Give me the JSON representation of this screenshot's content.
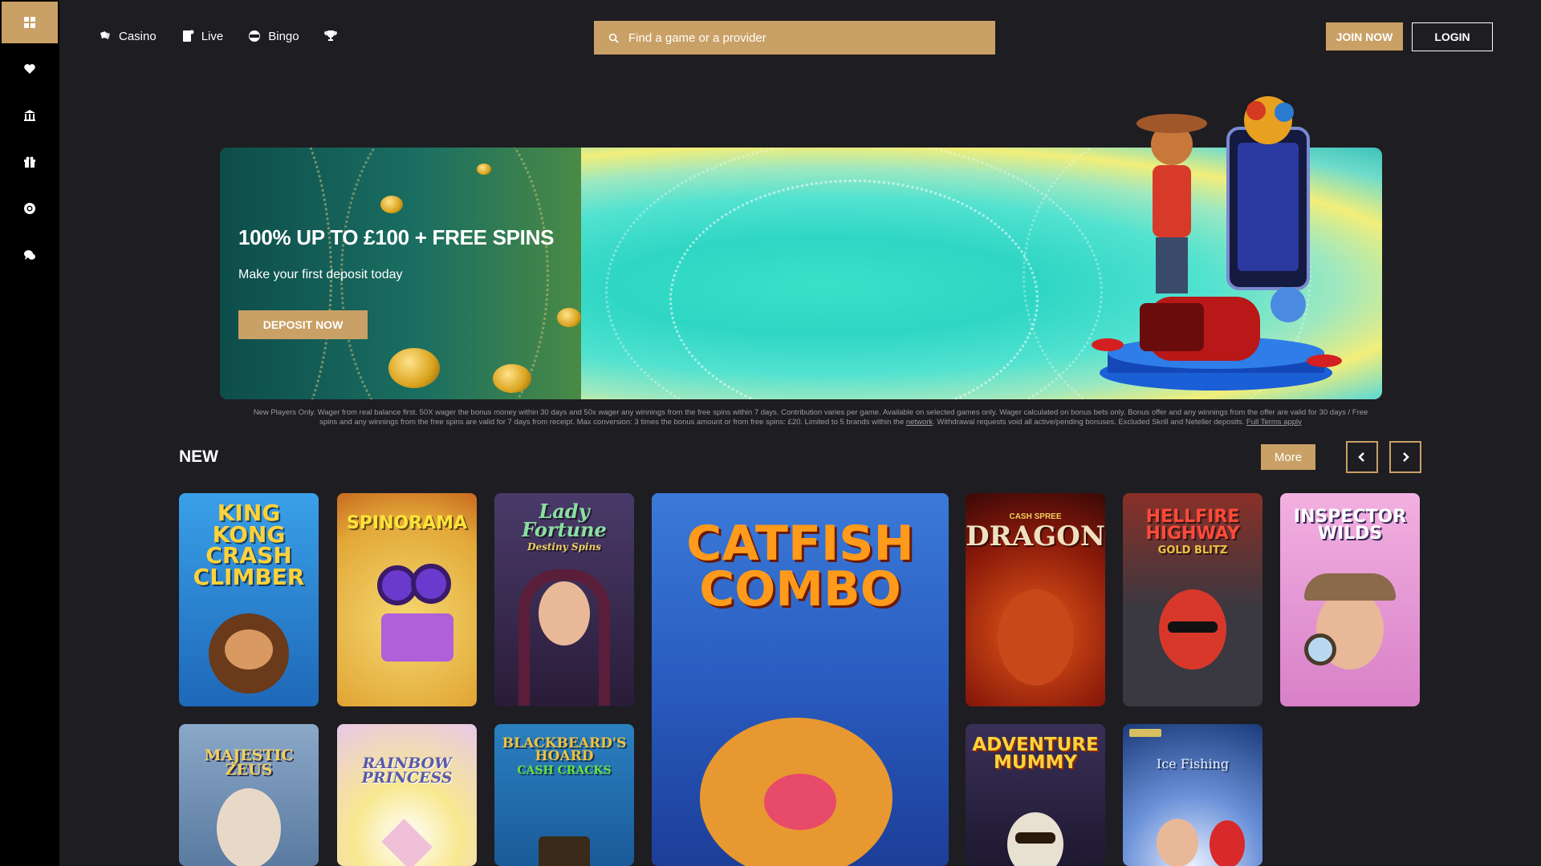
{
  "sidebar": {
    "items": [
      {
        "icon": "grid-icon"
      },
      {
        "icon": "heart-icon"
      },
      {
        "icon": "building-icon"
      },
      {
        "icon": "gift-icon"
      },
      {
        "icon": "lifebuoy-icon"
      },
      {
        "icon": "chat-icon"
      }
    ]
  },
  "header": {
    "nav": [
      {
        "label": "Casino",
        "icon": "cards-icon"
      },
      {
        "label": "Live",
        "icon": "live-cards-icon"
      },
      {
        "label": "Bingo",
        "icon": "bingo-ball-icon"
      },
      {
        "label": "",
        "icon": "trophy-icon"
      }
    ],
    "search_placeholder": "Find a game or a provider",
    "join_label": "JOIN NOW",
    "login_label": "LOGIN"
  },
  "banner": {
    "title": "100% UP TO £100 + FREE SPINS",
    "subtitle": "Make your first deposit today",
    "cta_label": "DEPOSIT NOW"
  },
  "terms": {
    "text_1": "New Players Only. Wager from real balance first. 50X wager the bonus money within 30 days and 50x wager any winnings from the free spins within 7 days. Contribution varies per game. Available on selected games only. Wager calculated on bonus bets only. Bonus offer and any winnings from the offer are valid for 30 days / Free spins and any winnings from the free spins are valid for 7 days from receipt. Max conversion: 3 times the bonus amount or from free spins: £20. Limited to 5 brands within the ",
    "link_network": "network",
    "text_2": ". Withdrawal requests void all active/pending bonuses. Excluded Skrill and Neteller deposits. ",
    "link_full_terms": "Full Terms apply"
  },
  "new_section": {
    "title": "NEW",
    "more_label": "More",
    "games": [
      {
        "title": "KING KONG CRASH CLIMBER",
        "bg": "#2a8fd6"
      },
      {
        "title": "SPINORAMA",
        "bg": "#e8c64a"
      },
      {
        "title": "Lady Fortune",
        "subtitle": "Destiny Spins",
        "bg": "#3a2448"
      },
      {
        "title": "CATFISH COMBO",
        "bg": "#2359b8"
      },
      {
        "title": "DRAGON",
        "badge": "CASH SPREE",
        "bg": "#7a1a10"
      },
      {
        "title": "HELLFIRE HIGHWAY",
        "subtitle": "GOLD BLITZ",
        "bg": "#3d3a40"
      },
      {
        "title": "INSPECTOR WILDS",
        "bg": "#e8a8d8"
      },
      {
        "title": "MAJESTIC ZEUS",
        "bg": "#6d92b8"
      },
      {
        "title": "RAINBOW PRINCESS",
        "bg": "#f0e6a8"
      },
      {
        "title": "BLACKBEARD'S HOARD",
        "subtitle": "CASH CRACKS",
        "bg": "#1e7fb8"
      },
      {
        "title": "ADVENTURE MUMMY",
        "bg": "#2c2440"
      },
      {
        "title": "Ice Fishing",
        "bg": "#1a3a7a"
      }
    ]
  }
}
